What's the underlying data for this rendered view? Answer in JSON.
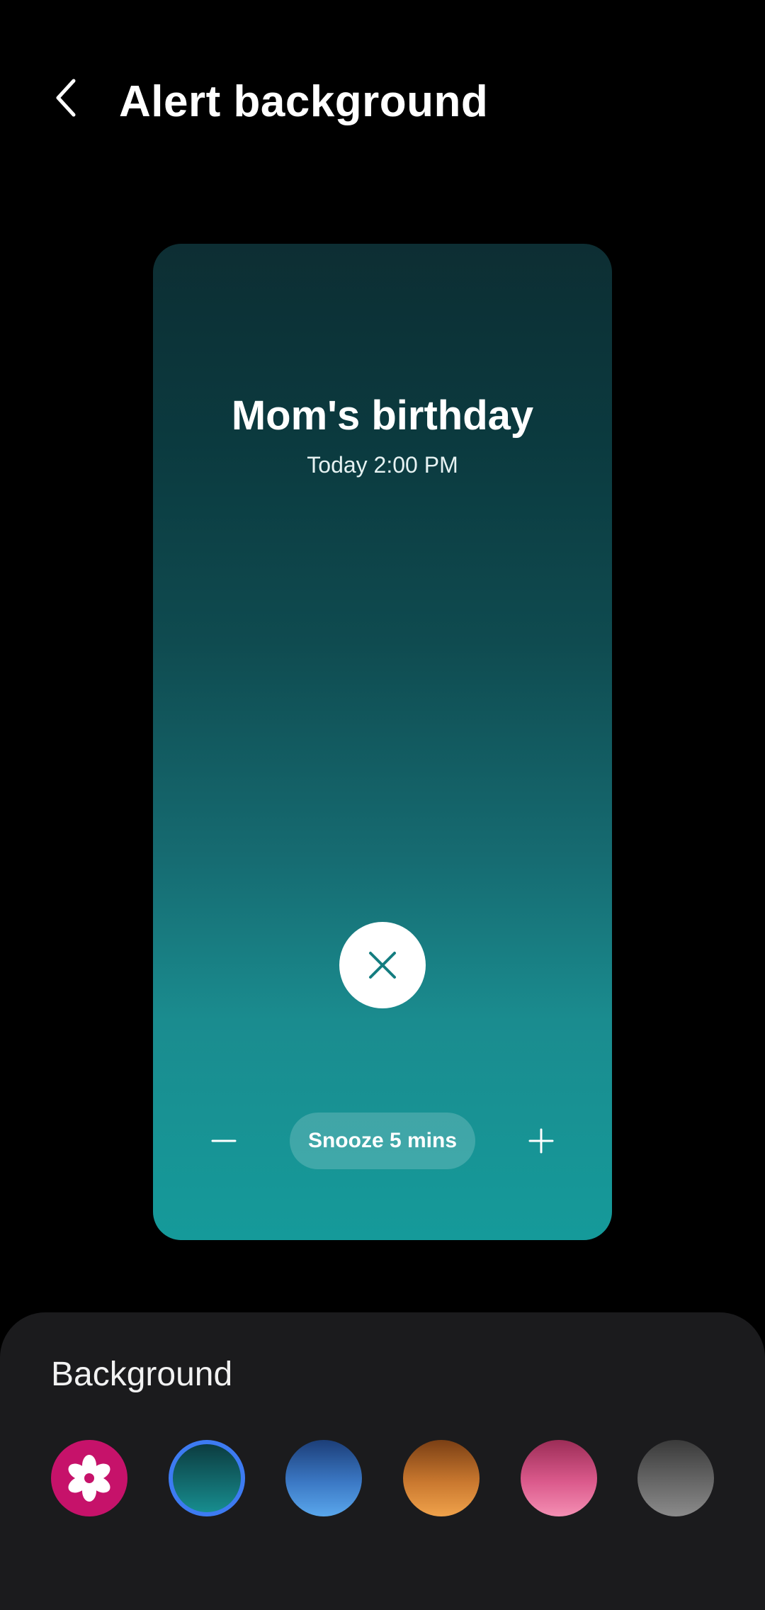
{
  "header": {
    "title": "Alert background",
    "back_icon": "chevron-left-icon"
  },
  "preview": {
    "alarm_name": "Mom's birthday",
    "alarm_time": "Today 2:00 PM",
    "dismiss_icon": "close-icon",
    "snooze_label": "Snooze 5 mins",
    "minus_icon": "minus-icon",
    "plus_icon": "plus-icon",
    "gradient_colors": [
      "#0d2e33",
      "#0f4b50",
      "#1a8c8f",
      "#159a9a"
    ]
  },
  "background_sheet": {
    "label": "Background",
    "options": [
      {
        "name": "flower",
        "color": "#c6126a",
        "icon": "flower-icon",
        "selected": false
      },
      {
        "name": "teal",
        "color": "#178d8f",
        "selected": true
      },
      {
        "name": "blue",
        "color": "#3b78c4",
        "selected": false
      },
      {
        "name": "orange",
        "color": "#c9782f",
        "selected": false
      },
      {
        "name": "pink",
        "color": "#db5a8c",
        "selected": false
      },
      {
        "name": "gray",
        "color": "#676767",
        "selected": false
      }
    ],
    "selection_ring_color": "#3d7bf2"
  }
}
